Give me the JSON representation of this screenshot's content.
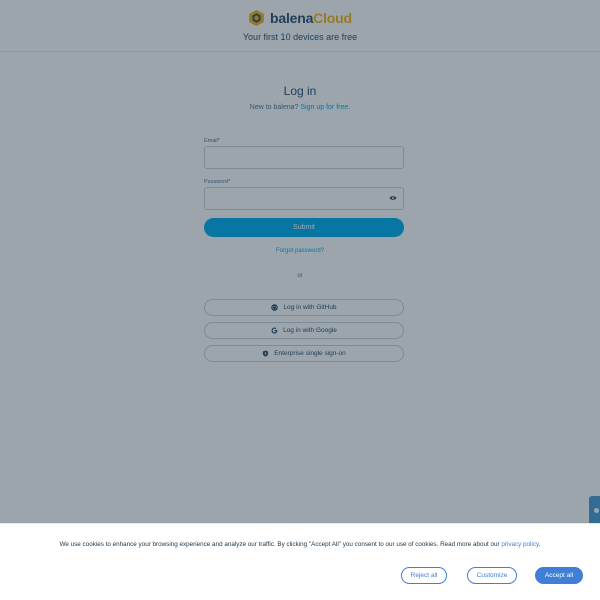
{
  "header": {
    "logo_word": "balena",
    "logo_suffix": "Cloud",
    "tagline": "Your first 10 devices are free"
  },
  "login": {
    "title": "Log in",
    "subtitle_prefix": "New to balena?",
    "signup_link": "Sign up for free.",
    "email_label": "Email",
    "password_label": "Password",
    "required_mark": "*",
    "email_value": "",
    "password_value": "",
    "submit_label": "Submit",
    "forgot_label": "Forgot password?",
    "or_label": "or",
    "github_label": "Log in with GitHub",
    "google_label": "Log in with Google",
    "sso_label": "Enterprise single sign-on"
  },
  "cookie_banner": {
    "text_prefix": "We use cookies to enhance your browsing experience and analyze our traffic. By clicking \"Accept All\" you consent to our use of cookies. Read more about our",
    "privacy_link": "privacy policy",
    "text_suffix": ".",
    "reject_label": "Reject all",
    "customize_label": "Customize",
    "accept_label": "Accept all"
  },
  "colors": {
    "brand_navy": "#2a506f",
    "brand_yellow": "#f7b51a",
    "accent_blue": "#00aeef",
    "cookie_blue": "#3f7fd6"
  },
  "icons": [
    "balena-cube-logo",
    "eye-icon",
    "github-icon",
    "google-icon",
    "shield-icon",
    "feedback-tab-icon"
  ]
}
